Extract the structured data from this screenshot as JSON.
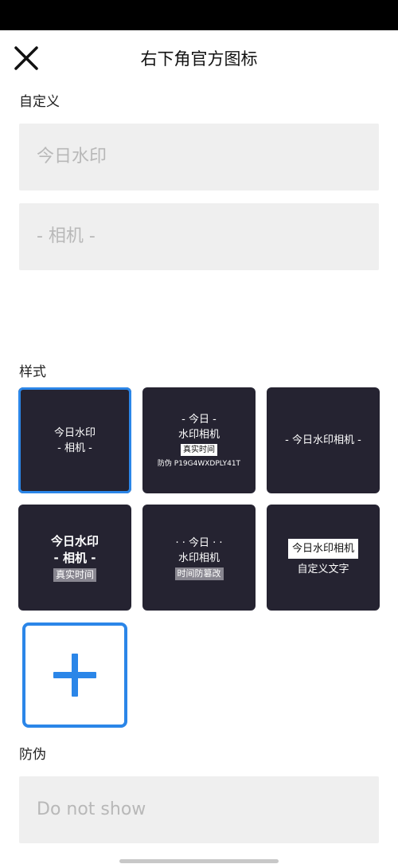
{
  "header": {
    "title": "右下角官方图标",
    "close_icon": "close-icon"
  },
  "custom": {
    "label": "自定义",
    "input1_placeholder": "今日水印",
    "input2_placeholder": "- 相机 -"
  },
  "style": {
    "label": "样式",
    "tiles": [
      {
        "lines": [
          "今日水印",
          "- 相机 -"
        ],
        "selected": true
      },
      {
        "lines": [
          "- 今日 -",
          "水印相机"
        ],
        "chip": "真实时间",
        "footer": "防伪 P19G4WXDPLY41T"
      },
      {
        "lines": [
          "- 今日水印相机 -"
        ]
      },
      {
        "lines": [
          "今日水印",
          "- 相机 -"
        ],
        "chip": "真实时间"
      },
      {
        "lines": [
          "· · 今日 · ·",
          "水印相机"
        ],
        "chip": "时间防篡改"
      },
      {
        "chip": "今日水印相机",
        "lines": [
          "自定义文字"
        ]
      }
    ],
    "add_icon": "plus-icon"
  },
  "anti_fake": {
    "label": "防伪",
    "value_placeholder": "Do not show"
  },
  "colors": {
    "accent": "#2b86e8",
    "tile_bg": "#252331",
    "input_bg": "#efefef"
  }
}
